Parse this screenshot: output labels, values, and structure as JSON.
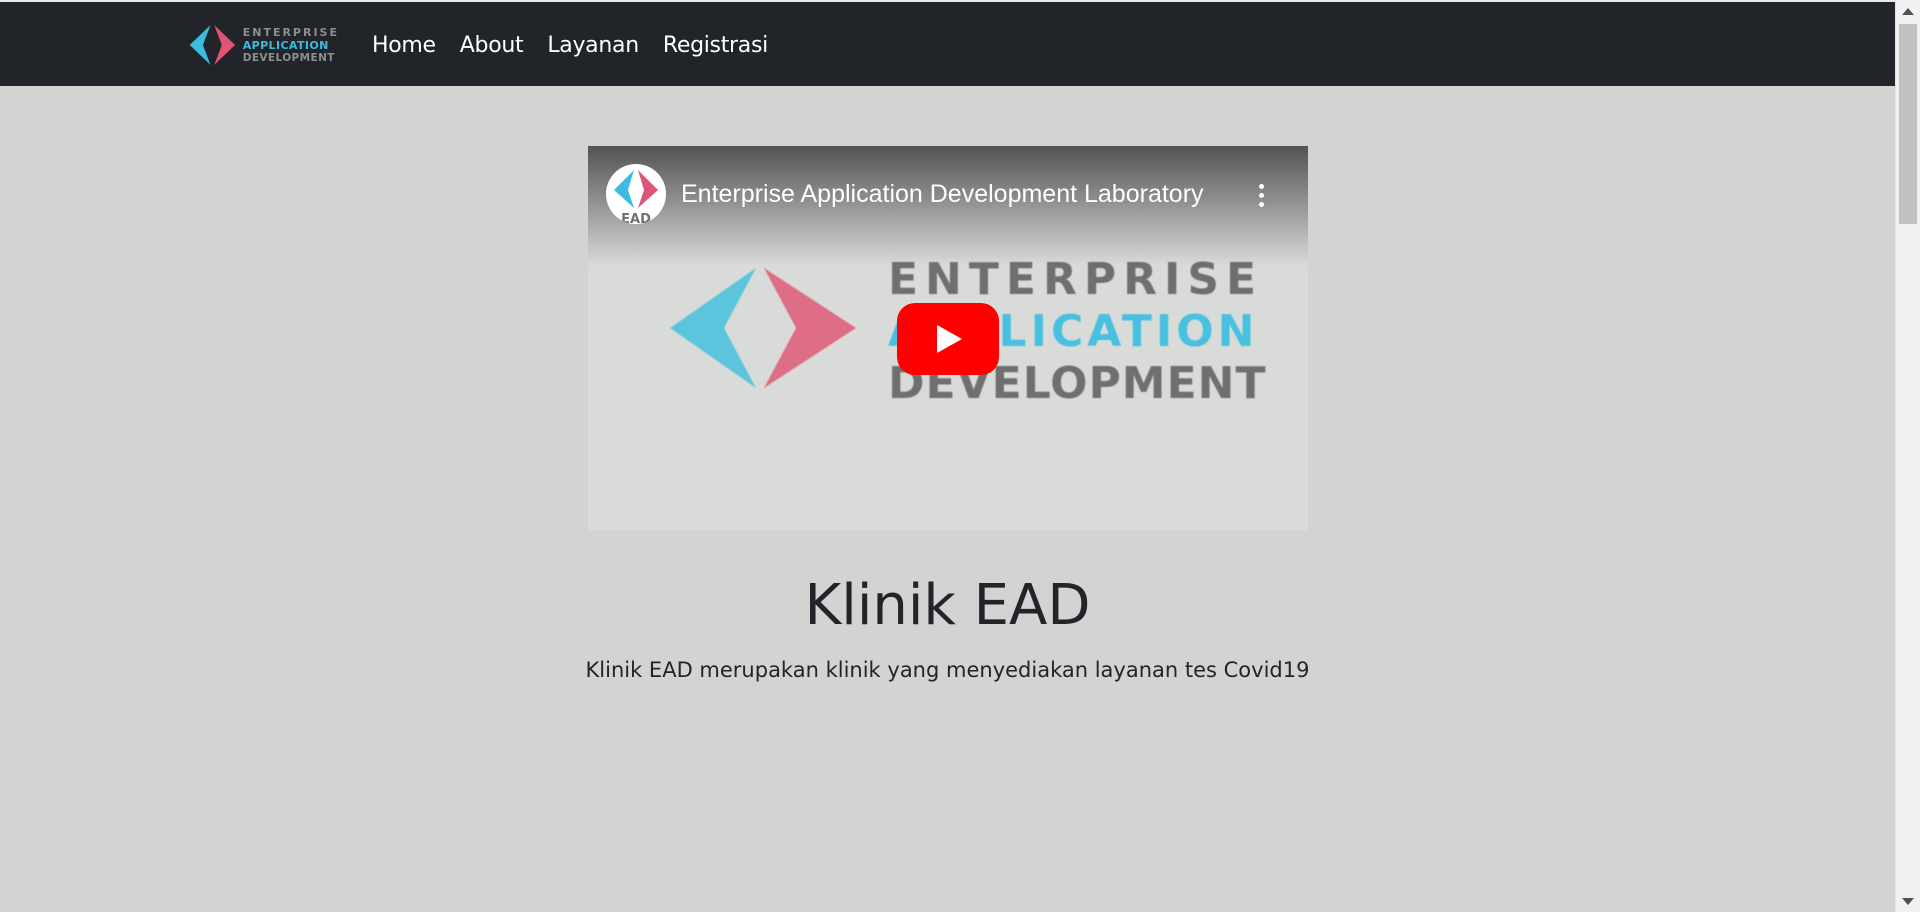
{
  "navbar": {
    "brand": {
      "line1": "ENTERPRISE",
      "line2": "APPLICATION",
      "line3": "DEVELOPMENT"
    },
    "links": [
      "Home",
      "About",
      "Layanan",
      "Registrasi"
    ]
  },
  "video": {
    "title": "Enterprise Application Development Laboratory",
    "avatar_text": "EAD",
    "wordmark": {
      "line1": "ENTERPRISE",
      "line2": "APPLICATION",
      "line3": "DEVELOPMENT"
    },
    "icons": {
      "play": "youtube-play-icon",
      "menu": "more-vert-icon"
    },
    "colors": {
      "play_red": "#ff0000",
      "brand_blue": "#3cbde0",
      "brand_pink": "#e05577"
    }
  },
  "hero": {
    "title": "Klinik EAD",
    "lead": "Klinik EAD merupakan klinik yang menyediakan layanan tes Covid19"
  },
  "colors": {
    "navbar_bg": "#212529",
    "page_bg": "#d3d3d3",
    "text": "#212529"
  }
}
